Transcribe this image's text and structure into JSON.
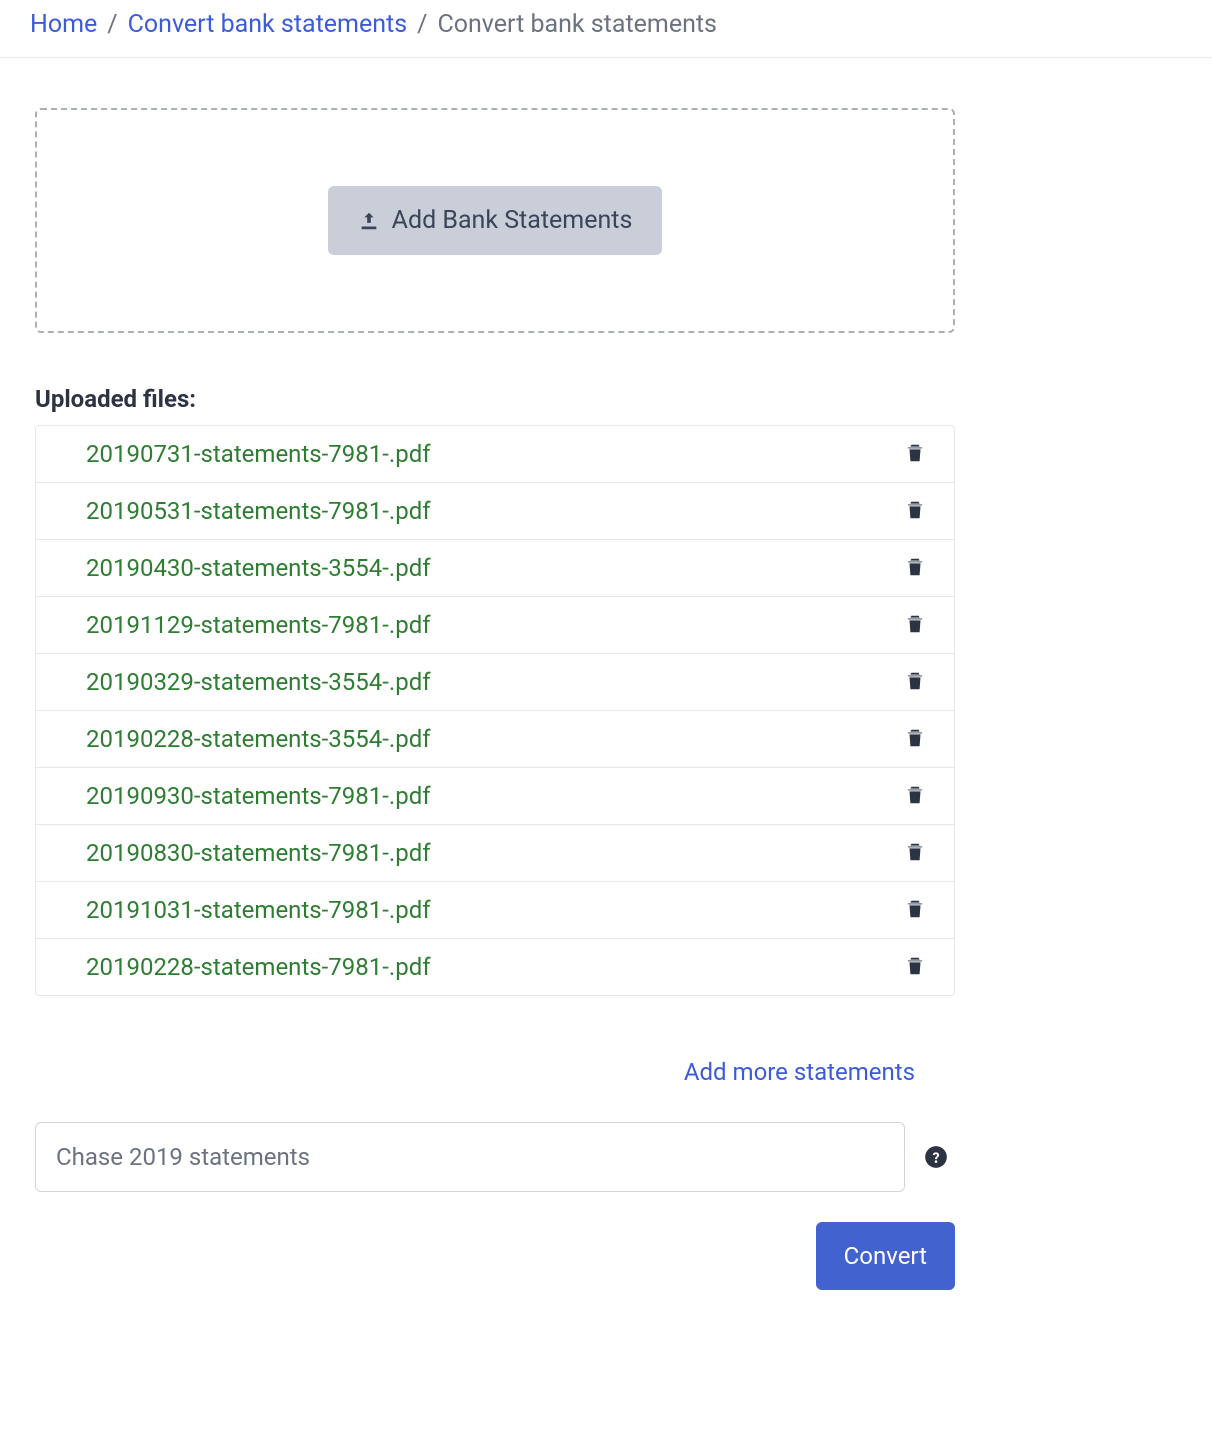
{
  "breadcrumb": {
    "items": [
      {
        "label": "Home",
        "link": true
      },
      {
        "label": "Convert bank statements",
        "link": true
      },
      {
        "label": "Convert bank statements",
        "link": false
      }
    ]
  },
  "dropzone": {
    "add_label": "Add Bank Statements"
  },
  "uploaded": {
    "heading": "Uploaded files:",
    "files": [
      {
        "name": "20190731-statements-7981-.pdf"
      },
      {
        "name": "20190531-statements-7981-.pdf"
      },
      {
        "name": "20190430-statements-3554-.pdf"
      },
      {
        "name": "20191129-statements-7981-.pdf"
      },
      {
        "name": "20190329-statements-3554-.pdf"
      },
      {
        "name": "20190228-statements-3554-.pdf"
      },
      {
        "name": "20190930-statements-7981-.pdf"
      },
      {
        "name": "20190830-statements-7981-.pdf"
      },
      {
        "name": "20191031-statements-7981-.pdf"
      },
      {
        "name": "20190228-statements-7981-.pdf"
      }
    ]
  },
  "actions": {
    "add_more_label": "Add more statements",
    "convert_label": "Convert"
  },
  "input": {
    "placeholder": "Chase 2019 statements",
    "value": ""
  }
}
